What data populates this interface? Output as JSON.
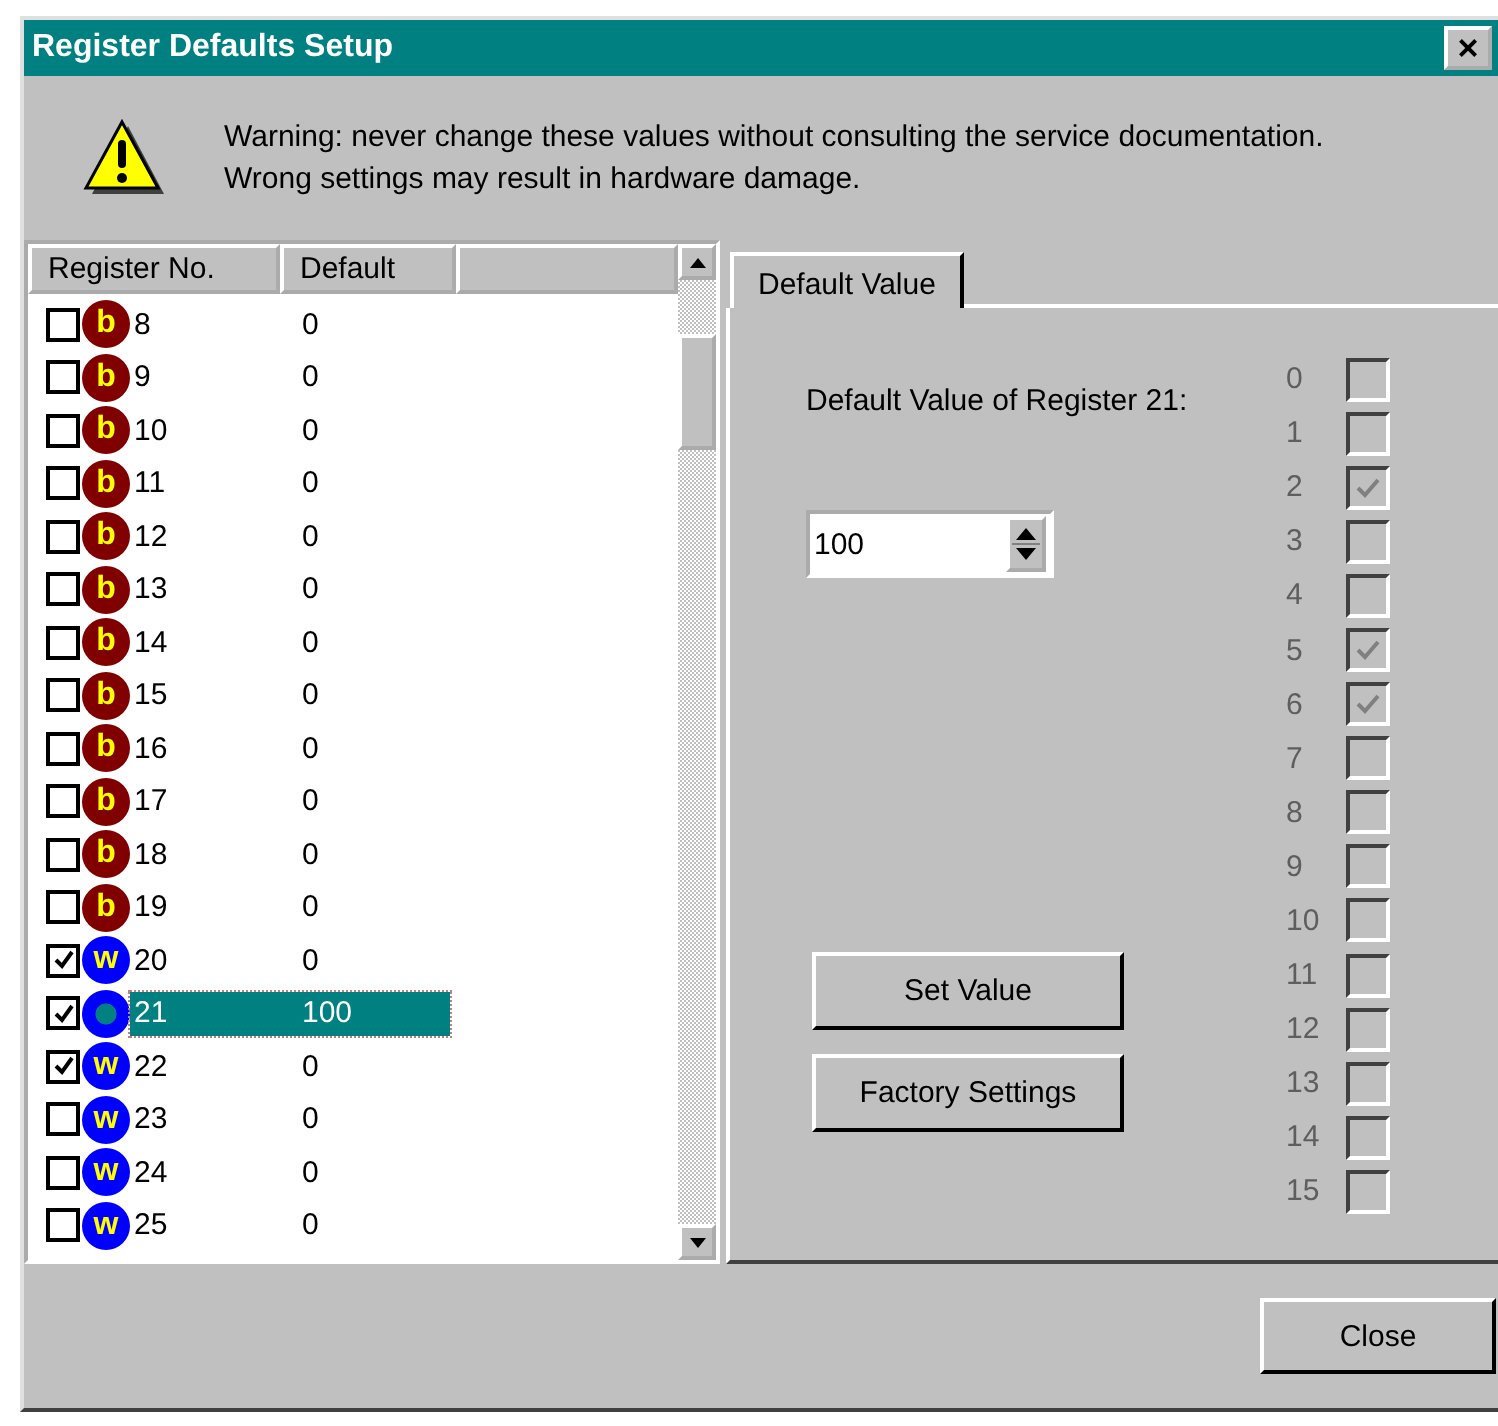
{
  "window": {
    "title": "Register Defaults Setup",
    "close_glyph": "×"
  },
  "warning": {
    "lines": [
      "Warning: never change these values without consulting the service documentation.",
      "Wrong settings may result in hardware damage."
    ]
  },
  "table": {
    "columns": [
      "Register No.",
      "Default"
    ],
    "rows": [
      {
        "checked": false,
        "kind": "bit",
        "letter": "b",
        "number": "8",
        "default": "0",
        "selected": false
      },
      {
        "checked": false,
        "kind": "bit",
        "letter": "b",
        "number": "9",
        "default": "0",
        "selected": false
      },
      {
        "checked": false,
        "kind": "bit",
        "letter": "b",
        "number": "10",
        "default": "0",
        "selected": false
      },
      {
        "checked": false,
        "kind": "bit",
        "letter": "b",
        "number": "11",
        "default": "0",
        "selected": false
      },
      {
        "checked": false,
        "kind": "bit",
        "letter": "b",
        "number": "12",
        "default": "0",
        "selected": false
      },
      {
        "checked": false,
        "kind": "bit",
        "letter": "b",
        "number": "13",
        "default": "0",
        "selected": false
      },
      {
        "checked": false,
        "kind": "bit",
        "letter": "b",
        "number": "14",
        "default": "0",
        "selected": false
      },
      {
        "checked": false,
        "kind": "bit",
        "letter": "b",
        "number": "15",
        "default": "0",
        "selected": false
      },
      {
        "checked": false,
        "kind": "bit",
        "letter": "b",
        "number": "16",
        "default": "0",
        "selected": false
      },
      {
        "checked": false,
        "kind": "bit",
        "letter": "b",
        "number": "17",
        "default": "0",
        "selected": false
      },
      {
        "checked": false,
        "kind": "bit",
        "letter": "b",
        "number": "18",
        "default": "0",
        "selected": false
      },
      {
        "checked": false,
        "kind": "bit",
        "letter": "b",
        "number": "19",
        "default": "0",
        "selected": false
      },
      {
        "checked": true,
        "kind": "word",
        "letter": "w",
        "number": "20",
        "default": "0",
        "selected": false
      },
      {
        "checked": true,
        "kind": "word",
        "number": "21",
        "default": "100",
        "selected": true
      },
      {
        "checked": true,
        "kind": "word",
        "letter": "w",
        "number": "22",
        "default": "0",
        "selected": false
      },
      {
        "checked": false,
        "kind": "word",
        "letter": "w",
        "number": "23",
        "default": "0",
        "selected": false
      },
      {
        "checked": false,
        "kind": "word",
        "letter": "w",
        "number": "24",
        "default": "0",
        "selected": false
      },
      {
        "checked": false,
        "kind": "word",
        "letter": "w",
        "number": "25",
        "default": "0",
        "selected": false
      }
    ]
  },
  "tabs": [
    {
      "label": "Default Value",
      "selected": true
    }
  ],
  "editor": {
    "label": "Default Value of Register 21:",
    "value": "100",
    "set_button": "Set Value",
    "factory_button": "Factory Settings",
    "bits_disabled": true,
    "bits": [
      {
        "label": "0",
        "checked": false
      },
      {
        "label": "1",
        "checked": false
      },
      {
        "label": "2",
        "checked": true
      },
      {
        "label": "3",
        "checked": false
      },
      {
        "label": "4",
        "checked": false
      },
      {
        "label": "5",
        "checked": true
      },
      {
        "label": "6",
        "checked": true
      },
      {
        "label": "7",
        "checked": false
      },
      {
        "label": "8",
        "checked": false
      },
      {
        "label": "9",
        "checked": false
      },
      {
        "label": "10",
        "checked": false
      },
      {
        "label": "11",
        "checked": false
      },
      {
        "label": "12",
        "checked": false
      },
      {
        "label": "13",
        "checked": false
      },
      {
        "label": "14",
        "checked": false
      },
      {
        "label": "15",
        "checked": false
      }
    ]
  },
  "buttons": [
    "Close"
  ]
}
